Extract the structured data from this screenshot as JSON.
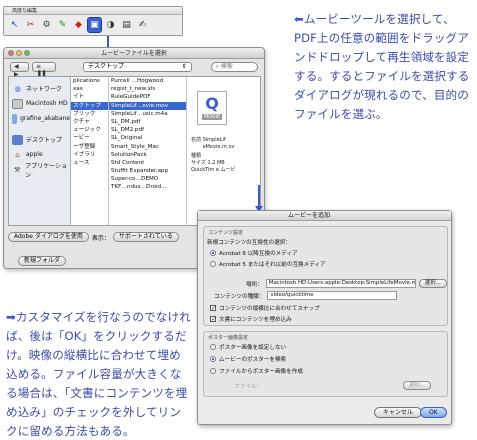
{
  "palette": {
    "title": "高度な編集",
    "tools": [
      "cursor-icon",
      "crop-icon",
      "stamp-icon",
      "sign-icon",
      "movie-tool-icon",
      "sound-icon",
      "form-icon",
      "field-icon",
      "object-icon"
    ]
  },
  "file_dialog": {
    "title": "ムービーファイルを選択",
    "location": "デスクトップ",
    "search_placeholder": "検索",
    "sidebar": [
      {
        "label": "ネットワーク",
        "icon": "network-icon"
      },
      {
        "label": "Macintosh HD",
        "icon": "hard-disk-icon"
      },
      {
        "label": "grafine_akabane",
        "icon": "user-folder-icon"
      },
      {
        "label": "デスクトップ",
        "icon": "desktop-icon"
      },
      {
        "label": "apple",
        "icon": "home-icon"
      },
      {
        "label": "アプリケーション",
        "icon": "applications-icon"
      }
    ],
    "column1": [
      "plications",
      "xas",
      "イト",
      "スクトップ",
      "ブリック",
      "クチャ",
      "ュージック",
      "ービー",
      "ーザ登録",
      "イブラリ",
      "ュース"
    ],
    "column1_selected": 3,
    "column2": [
      "Purcell …Hogwood",
      "regist_t_new.xls",
      "RuleGuidePDF",
      "SimpleLif…ovie.mov",
      "SimpleLif…usic.m4a",
      "SL_DM.pdf",
      "SL_DM2.pdf",
      "SL_Original",
      "Smart_Style_Mac",
      "SolutionPack",
      "Std Content",
      "Stuffit Expander.app",
      "Super-co…DEMO",
      "TKF…ndus…Droid…"
    ],
    "column2_selected": 3,
    "preview": {
      "icon_label": "MOVIE",
      "name_label": "名前",
      "name_value": "SimpleLif eMovie.m ov",
      "kind_label": "種類",
      "size_label": "サイズ",
      "size_value": "1.2 MB",
      "kind_value": "QuickTim e ムービ"
    },
    "use_button": "Adobe ダイアログを使用",
    "show_label": "表示：",
    "show_value": "サポートされている",
    "new_folder_button": "新規フォルダ"
  },
  "options_panel": {
    "title": "ムービーを追加",
    "content_group_title": "コンテンツ設定",
    "compat_label": "新規コンテンツの互換性の選択：",
    "compat_options": [
      "Acrobat 6 以降互換のメディア",
      "Acrobat 5 またはそれ以前の互換メディア"
    ],
    "compat_selected": 0,
    "location_label": "場所：",
    "location_value": "Macintosh HD:Users:apple:Desktop:SimpleLifeMovie.mo",
    "browse_button": "選択...",
    "type_label": "コンテンツの種類：",
    "type_value": "video/quicktime",
    "checkboxes": [
      "コンテンツの縦横比に合わせてスナップ",
      "文書にコンテンツを埋め込み"
    ],
    "poster_group_title": "ポスター画像設定",
    "poster_options": [
      "ポスター画像を設定しない",
      "ムービーのポスターを検索",
      "ファイルからポスター画像を作成"
    ],
    "poster_selected": 1,
    "file_label": "ファイル：",
    "file_browse_button": "選択...",
    "cancel_button": "キャンセル",
    "ok_button": "OK"
  },
  "text_top": {
    "arrow": "⬅",
    "body": "ムービーツールを選択して、PDF上の任意の範囲をドラッグアンドドロップして再生領域を設定する。するとファイルを選択するダイアログが現れるので、目的のファイルを選ぶ。"
  },
  "text_bottom": {
    "arrow": "➡",
    "body": "カスタマイズを行なうのでなければ、後は「OK」をクリックするだけ。映像の縦横比に合わせて埋め込める。ファイル容量が大きくなる場合は、「文書にコンテンツを埋め込み」のチェックを外してリンクに留める方法もある。"
  },
  "colors": {
    "accent": "#3b57c8",
    "text": "#3c4bab",
    "selection": "#3a66d1"
  }
}
